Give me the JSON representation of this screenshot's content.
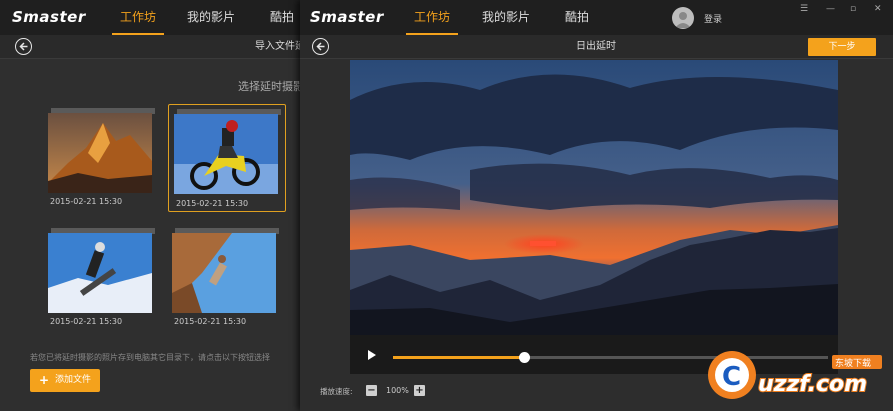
{
  "app": {
    "logo_text": "Smaster"
  },
  "nav": {
    "tabs": [
      "工作坊",
      "我的影片",
      "酷拍"
    ],
    "active": 0
  },
  "back_window": {
    "subtitle": "导入文件延",
    "pick_hint": "选择延时摄影",
    "albums": [
      {
        "date": "2015-02-21  15:30",
        "scene": "mountain"
      },
      {
        "date": "2015-02-21  15:30",
        "scene": "motocross",
        "selected": true
      },
      {
        "date": "2015-02-21  15:30",
        "scene": "snowboard"
      },
      {
        "date": "2015-02-21  15:30",
        "scene": "climbing"
      }
    ],
    "tip": "若您已将延时摄影的照片存到电脑其它目录下，请点击以下按钮选择",
    "add_button": "添加文件"
  },
  "front_window": {
    "login": "登录",
    "title": "日出延时",
    "next_button": "下一步",
    "window_controls": [
      "☰",
      "—",
      "▫",
      "✕"
    ],
    "player": {
      "progress": 0.3
    },
    "speed": {
      "label": "播放速度:",
      "value": "100%",
      "minus": "−",
      "plus": "+"
    }
  },
  "watermark": {
    "text": "uzzf.com",
    "sub": "东坡下载"
  },
  "colors": {
    "accent": "#f4a21c",
    "topbar": "#1f1f1f",
    "panel": "#2d2d2d"
  },
  "icons": [
    "back-arrow-icon",
    "play-icon",
    "plus-icon",
    "user-avatar-icon",
    "menu-icon",
    "minimize-icon",
    "maximize-icon",
    "close-icon"
  ]
}
